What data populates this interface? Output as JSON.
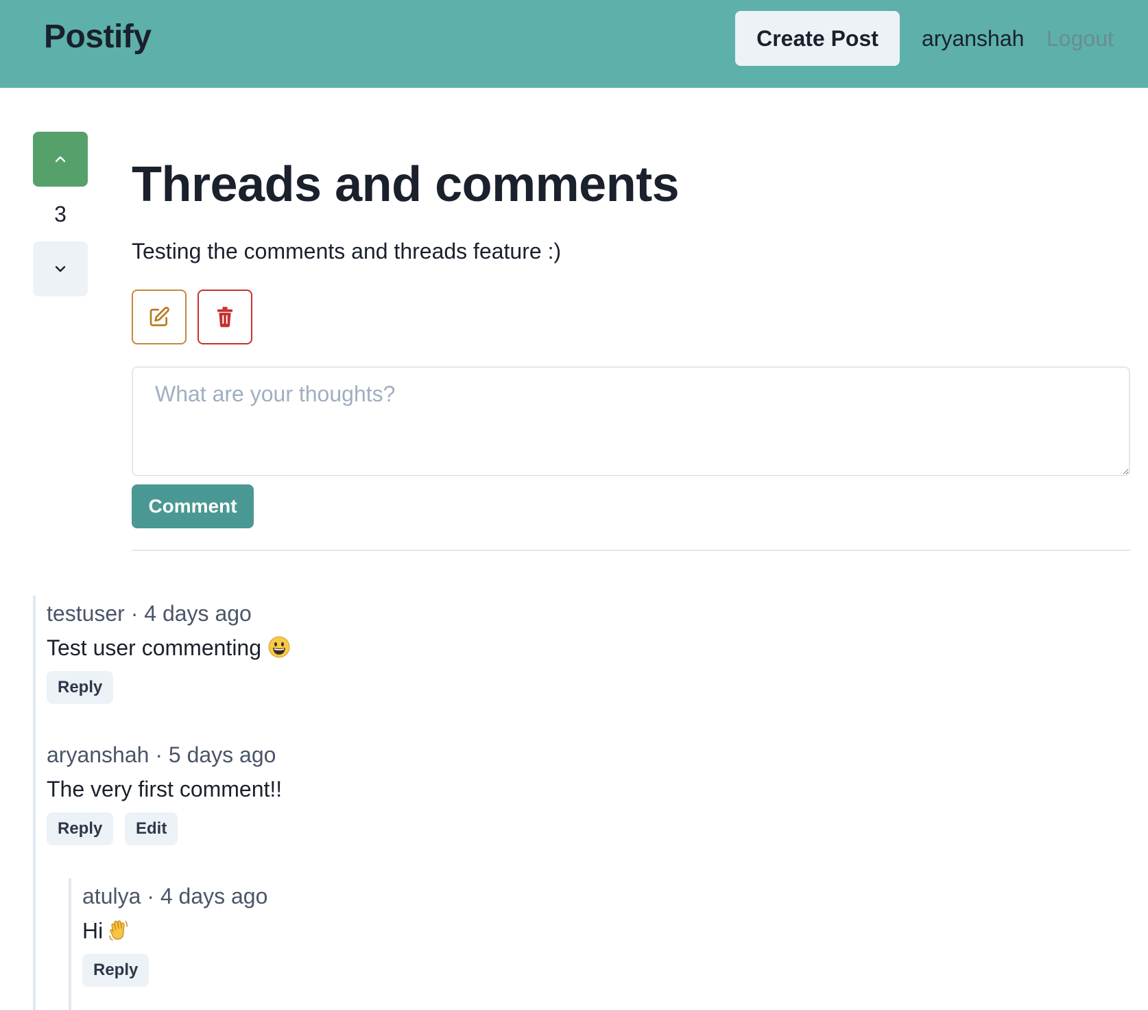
{
  "navbar": {
    "brand": "Postify",
    "create_post_label": "Create Post",
    "username": "aryanshah",
    "logout_label": "Logout"
  },
  "post": {
    "vote_count": "3",
    "title": "Threads and comments",
    "body": "Testing the comments and threads feature :)"
  },
  "comment_form": {
    "placeholder": "What are your thoughts?",
    "submit_label": "Comment"
  },
  "comments": [
    {
      "meta": "testuser · 4 days ago",
      "text": "Test user commenting",
      "emoji": "grinning-face",
      "reply_label": "Reply"
    },
    {
      "meta": "aryanshah · 5 days ago",
      "text": "The very first comment!!",
      "reply_label": "Reply",
      "edit_label": "Edit",
      "replies": [
        {
          "meta": "atulya · 4 days ago",
          "text": "Hi",
          "emoji": "waving-hand",
          "reply_label": "Reply"
        }
      ]
    }
  ]
}
